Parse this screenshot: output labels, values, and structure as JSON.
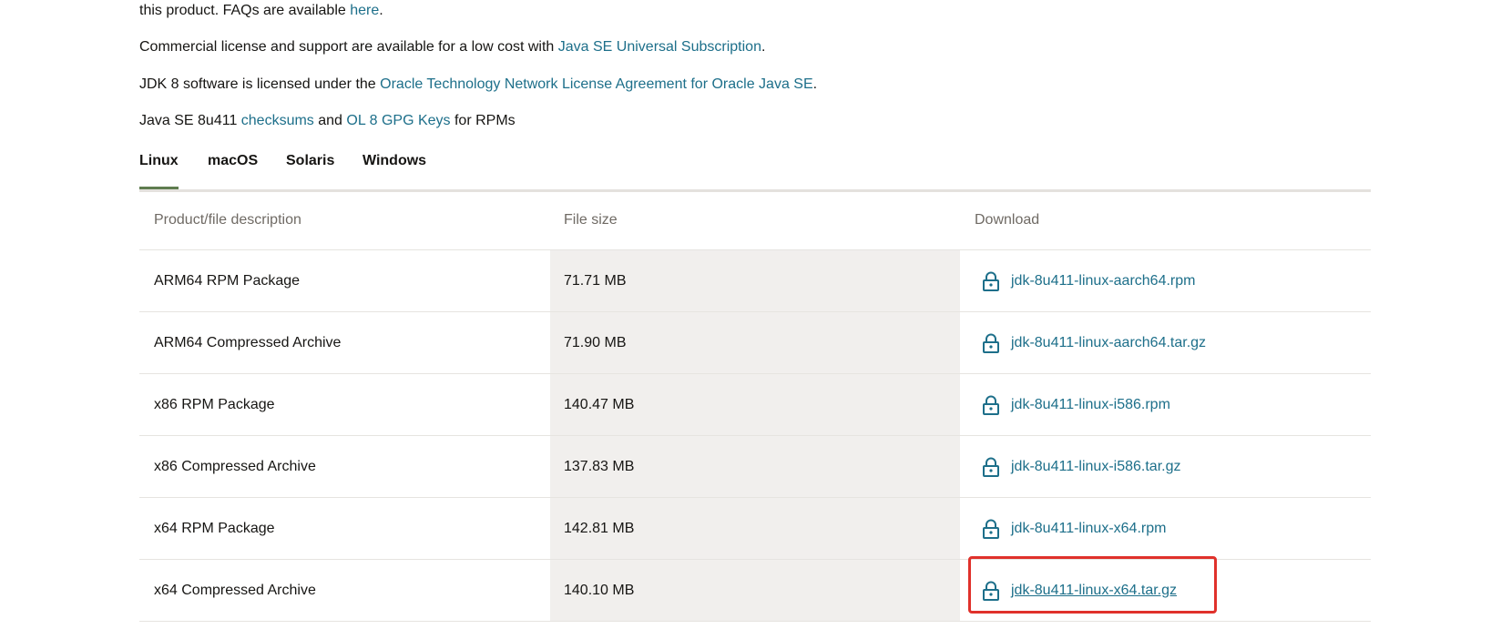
{
  "intro": {
    "p1_text": "this product. FAQs are available ",
    "p1_link": "here",
    "p1_end": ".",
    "p2_text": "Commercial license and support are available for a low cost with ",
    "p2_link": "Java SE Universal Subscription",
    "p2_end": ".",
    "p3_text": "JDK 8 software is licensed under the ",
    "p3_link": "Oracle Technology Network License Agreement for Oracle Java SE",
    "p3_end": ".",
    "p4_text": "Java SE 8u411 ",
    "p4_link1": "checksums",
    "p4_mid": " and ",
    "p4_link2": "OL 8 GPG Keys",
    "p4_end": " for RPMs"
  },
  "tabs": [
    {
      "label": "Linux",
      "active": true
    },
    {
      "label": "macOS",
      "active": false
    },
    {
      "label": "Solaris",
      "active": false
    },
    {
      "label": "Windows",
      "active": false
    }
  ],
  "table": {
    "headers": {
      "description": "Product/file description",
      "size": "File size",
      "download": "Download"
    },
    "rows": [
      {
        "description": "ARM64 RPM Package",
        "size": "71.71 MB",
        "file": "jdk-8u411-linux-aarch64.rpm"
      },
      {
        "description": "ARM64 Compressed Archive",
        "size": "71.90 MB",
        "file": "jdk-8u411-linux-aarch64.tar.gz"
      },
      {
        "description": "x86 RPM Package",
        "size": "140.47 MB",
        "file": "jdk-8u411-linux-i586.rpm"
      },
      {
        "description": "x86 Compressed Archive",
        "size": "137.83 MB",
        "file": "jdk-8u411-linux-i586.tar.gz"
      },
      {
        "description": "x64 RPM Package",
        "size": "142.81 MB",
        "file": "jdk-8u411-linux-x64.rpm"
      },
      {
        "description": "x64 Compressed Archive",
        "size": "140.10 MB",
        "file": "jdk-8u411-linux-x64.tar.gz"
      }
    ]
  },
  "colors": {
    "link": "#1d6f8a",
    "active_tab": "#5f7d4f",
    "highlight": "#e0312b",
    "icon": "lock-icon"
  }
}
